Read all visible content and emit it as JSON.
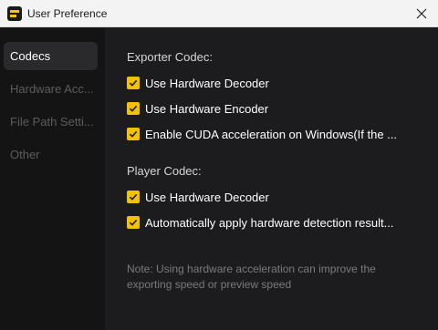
{
  "window": {
    "title": "User Preference"
  },
  "sidebar": {
    "items": [
      {
        "label": "Codecs",
        "active": true
      },
      {
        "label": "Hardware Acc..."
      },
      {
        "label": "File Path Setti..."
      },
      {
        "label": "Other"
      }
    ]
  },
  "exporter": {
    "heading": "Exporter Codec:",
    "options": [
      {
        "label": "Use Hardware Decoder",
        "checked": true
      },
      {
        "label": "Use Hardware Encoder",
        "checked": true
      },
      {
        "label": "Enable CUDA acceleration on Windows(If the ...",
        "checked": true
      }
    ]
  },
  "player": {
    "heading": "Player Codec:",
    "options": [
      {
        "label": "Use Hardware Decoder",
        "checked": true
      },
      {
        "label": "Automatically apply hardware detection result...",
        "checked": true
      }
    ]
  },
  "note": "Note: Using hardware acceleration can improve the exporting speed or preview speed",
  "colors": {
    "accent": "#f2c200",
    "sidebar_bg": "#141414",
    "content_bg": "#1c1c1e",
    "titlebar_bg": "#f3f3f3"
  }
}
